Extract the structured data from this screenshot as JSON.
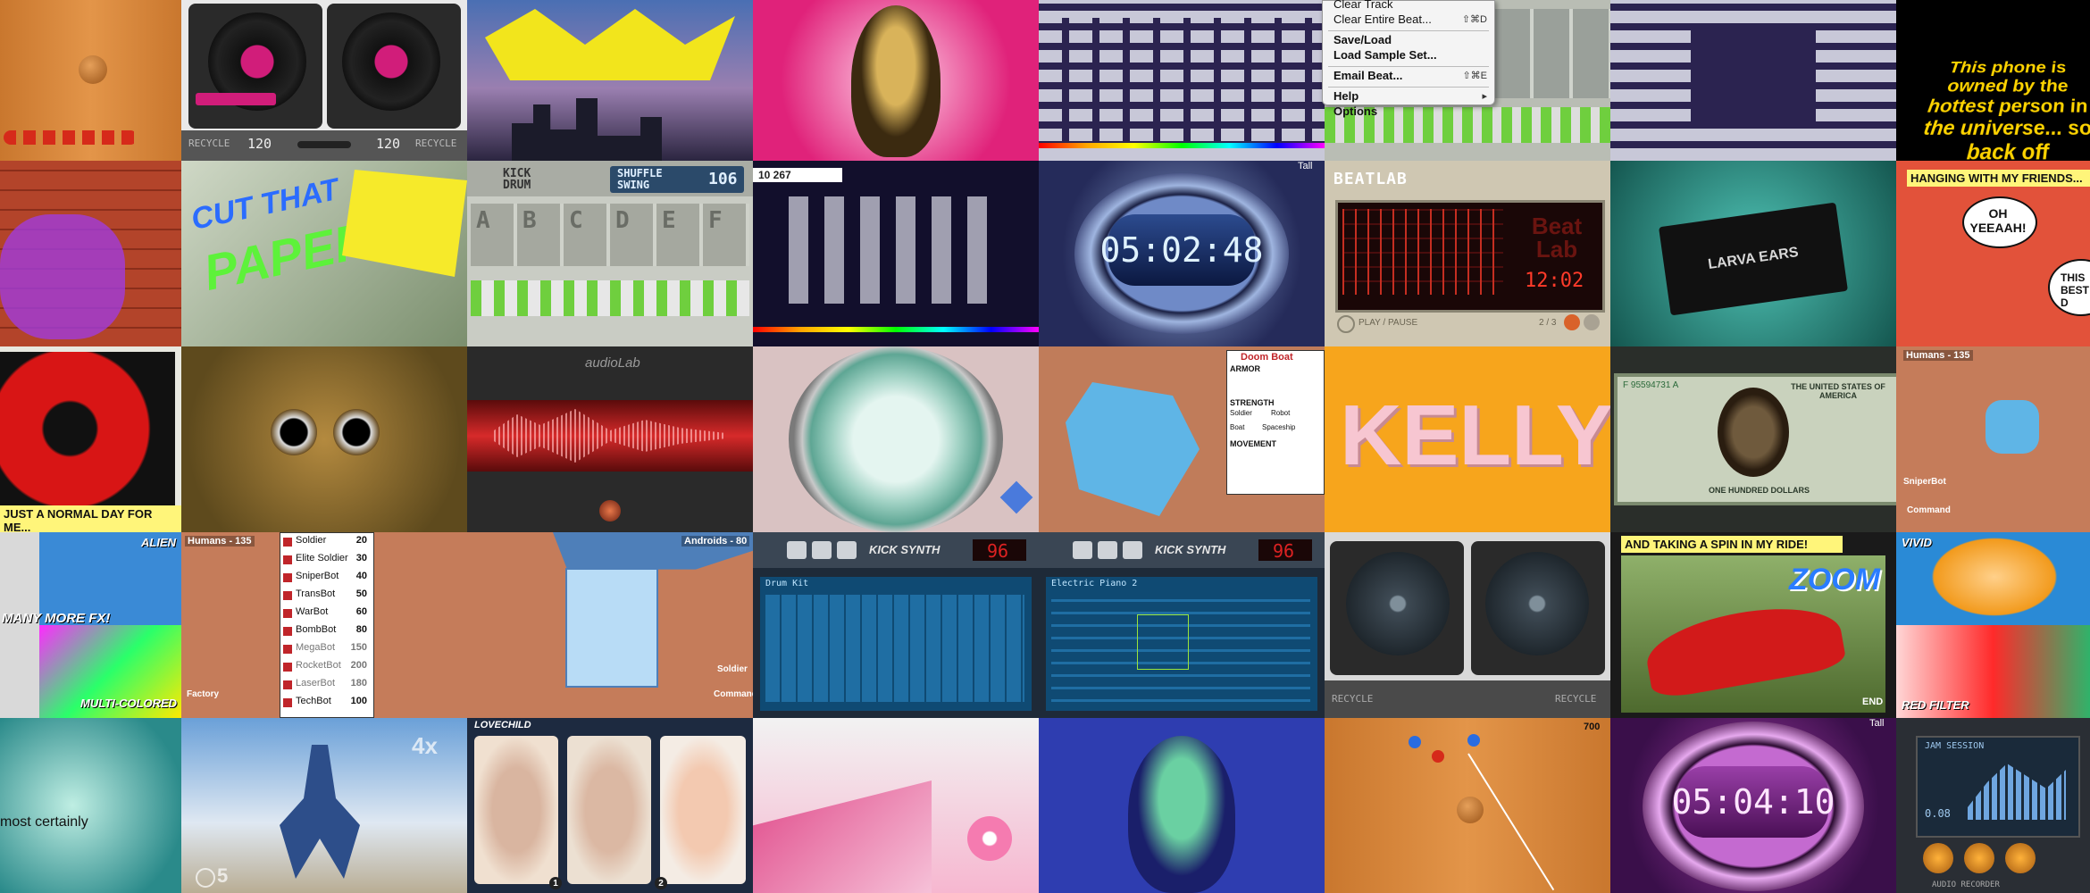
{
  "texts": {
    "deck_bpm_left": "120",
    "deck_bpm_right": "120",
    "deck_logo_left": "RECYCLE",
    "deck_logo_right": "RECYCLE",
    "starwars": "This phone is owned by the hottest person in the universe... so back off",
    "graffiti_1": "CUT THAT",
    "graffiti_2": "PAPER",
    "kick_drum": "KICK DRUM",
    "shuffle_swing": "SHUFFLE SWING",
    "tempo": "106",
    "drum_pads": [
      "A",
      "B",
      "C",
      "D",
      "E",
      "F"
    ],
    "game_status": "10  267",
    "clock_blue": "05:02:48",
    "beatlab_title": "BEATLAB",
    "beatlab_big": "Beat Lab",
    "beatlab_time": "12:02",
    "play_pause": "PLAY / PAUSE",
    "page_count": "2 / 3",
    "larva_ears": "LARVA EARS",
    "comic_top": "HANGING WITH MY FRIENDS...",
    "comic_bubble1": "OH YEEAAH!",
    "comic_bubble2": "THIS BEST D",
    "normal_day": "JUST A NORMAL DAY FOR ME...",
    "audiolab": "audioLab",
    "kelly": "KELLY",
    "humans_135": "Humans - 135",
    "sniperbot": "SniperBot",
    "command": "Command",
    "doom_boat": "Doom Boat",
    "alien": "ALIEN",
    "many_more_fx": "MANY MORE FX!",
    "multi_colored": "MULTI-COLORED",
    "factory": "Factory",
    "androids_80": "Androids - 80",
    "soldier": "Soldier",
    "kick_synth": "KICK SYNTH",
    "synth_tempo": "96",
    "drum_kit": "Drum Kit",
    "electric_piano": "Electric Piano 2",
    "spin_ride": "AND TAKING A SPIN IN MY RIDE!",
    "zoom": "ZOOM",
    "end": "END",
    "vivid": "VIVID",
    "red_filter": "RED FILTER",
    "most_certainly": "most certainly",
    "skate_4x": "4x",
    "skate_5": "5",
    "lovechild": "LOVECHILD",
    "slider_1": "1",
    "slider_2": "2",
    "pool_score": "700",
    "clock_pink": "05:04:10",
    "jam_session": "JAM SESSION",
    "audio_recorder": "AUDIO RECORDER",
    "rec_time": "0.08",
    "dollar_serial": "F 95594731 A",
    "dollar_header": "THE UNITED STATES OF AMERICA",
    "dollar_denom": "ONE HUNDRED DOLLARS",
    "tall_label": "Tall"
  },
  "unit_list": [
    {
      "name": "Soldier",
      "cost": "20"
    },
    {
      "name": "Elite Soldier",
      "cost": "30"
    },
    {
      "name": "SniperBot",
      "cost": "40"
    },
    {
      "name": "TransBot",
      "cost": "50"
    },
    {
      "name": "WarBot",
      "cost": "60"
    },
    {
      "name": "BombBot",
      "cost": "80"
    },
    {
      "name": "MegaBot",
      "cost": "150"
    },
    {
      "name": "RocketBot",
      "cost": "200"
    },
    {
      "name": "LaserBot",
      "cost": "180"
    },
    {
      "name": "TechBot",
      "cost": "100"
    }
  ],
  "menu": {
    "items": [
      {
        "label": "Clear Track",
        "shortcut": ""
      },
      {
        "label": "Clear Entire Beat...",
        "shortcut": "⇧⌘D"
      },
      {
        "label": "Save/Load",
        "shortcut": ""
      },
      {
        "label": "Load Sample Set...",
        "shortcut": ""
      },
      {
        "label": "Email Beat...",
        "shortcut": "⇧⌘E"
      },
      {
        "label": "Help",
        "shortcut": "▸"
      },
      {
        "label": "Options",
        "shortcut": ""
      }
    ]
  },
  "stats": {
    "armor": "ARMOR",
    "strength": "STRENGTH",
    "movement": "MOVEMENT",
    "soldier": "Soldier",
    "robot": "Robot",
    "boat": "Boat",
    "spaceship": "Spaceship"
  },
  "colors": {
    "accent_pink": "#e0227a",
    "lcd_blue": "#bfe6ff",
    "beatlab_red": "#d11a1a",
    "kelly_bg": "#f7a51c",
    "kelly_text": "#f7c6d1"
  }
}
